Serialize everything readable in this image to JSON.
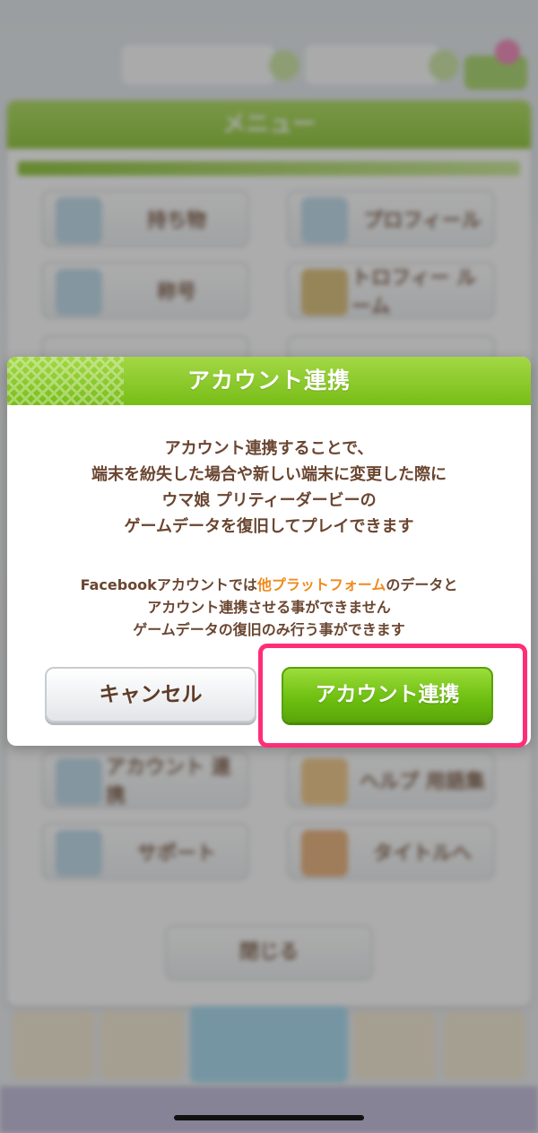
{
  "background": {
    "menu_title": "メニュー",
    "tiles": [
      {
        "label": "持ち物"
      },
      {
        "label": "プロフィール"
      },
      {
        "label": "称号"
      },
      {
        "label": "トロフィー ルーム"
      },
      {
        "label": "アカウント 連携"
      },
      {
        "label": "ヘルプ 用語集"
      },
      {
        "label": "サポート"
      },
      {
        "label": "タイトルへ"
      }
    ],
    "close_label": "閉じる"
  },
  "dialog": {
    "title": "アカウント連携",
    "para1": [
      "アカウント連携することで、",
      "端末を紛失した場合や新しい端末に変更した際に",
      "ウマ娘 プリティーダービーの",
      "ゲームデータを復旧してプレイできます"
    ],
    "para2": {
      "line1_prefix": "Facebookアカウントでは",
      "line1_highlight": "他プラットフォーム",
      "line1_suffix": "のデータと",
      "line2": "アカウント連携させる事ができません",
      "line3": "ゲームデータの復旧のみ行う事ができます"
    },
    "cancel_label": "キャンセル",
    "confirm_label": "アカウント連携"
  },
  "colors": {
    "accent_green": "#7fbf1e",
    "highlight_orange": "#f08a1c",
    "annotation_pink": "#ff2d78",
    "text_brown": "#6a4530"
  }
}
